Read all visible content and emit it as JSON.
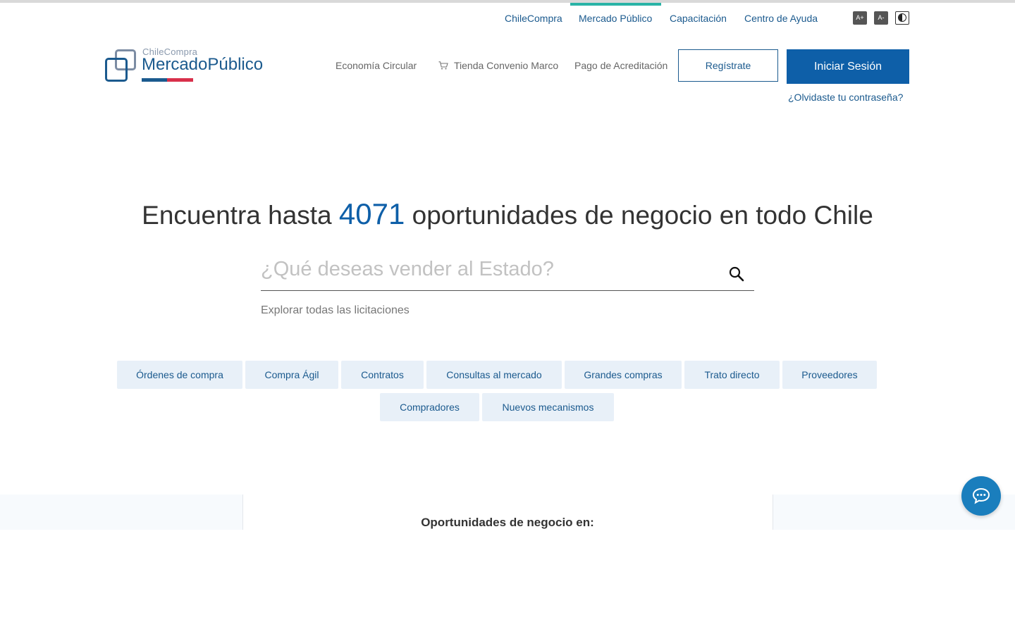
{
  "utility_nav": {
    "items": [
      {
        "label": "ChileCompra"
      },
      {
        "label": "Mercado Público",
        "active": true
      },
      {
        "label": "Capacitación"
      },
      {
        "label": "Centro de Ayuda"
      }
    ],
    "font_increase": "A+",
    "font_decrease": "A-",
    "contrast_icon": "contrast-icon"
  },
  "logo": {
    "small_text": "ChileCompra",
    "big_text": "MercadoPúblico"
  },
  "main_nav": {
    "items": [
      {
        "label": "Economía Circular"
      },
      {
        "label": "Tienda Convenio Marco",
        "icon": "cart-icon"
      },
      {
        "label": "Pago de Acreditación"
      }
    ],
    "register_label": "Regístrate",
    "login_label": "Iniciar Sesión",
    "forgot_label": "¿Olvidaste tu contraseña?"
  },
  "hero": {
    "title_before": "Encuentra hasta ",
    "count": "4071",
    "title_after": " oportunidades de negocio en todo Chile",
    "search_placeholder": "¿Qué deseas vender al Estado?",
    "search_value": "",
    "explore_label": "Explorar todas las licitaciones"
  },
  "categories": [
    {
      "label": "Órdenes de compra"
    },
    {
      "label": "Compra Ágil"
    },
    {
      "label": "Contratos"
    },
    {
      "label": "Consultas al mercado"
    },
    {
      "label": "Grandes compras"
    },
    {
      "label": "Trato directo"
    },
    {
      "label": "Proveedores"
    },
    {
      "label": "Compradores"
    },
    {
      "label": "Nuevos mecanismos"
    }
  ],
  "section": {
    "title": "Oportunidades de negocio en:"
  },
  "colors": {
    "brand_blue": "#0e5fa8",
    "brand_red": "#d8304b",
    "active_teal": "#2ab3a6",
    "chip_bg": "#e8f0f8",
    "chat_blue": "#1a7ebd"
  },
  "chat": {
    "icon": "chat-icon"
  }
}
